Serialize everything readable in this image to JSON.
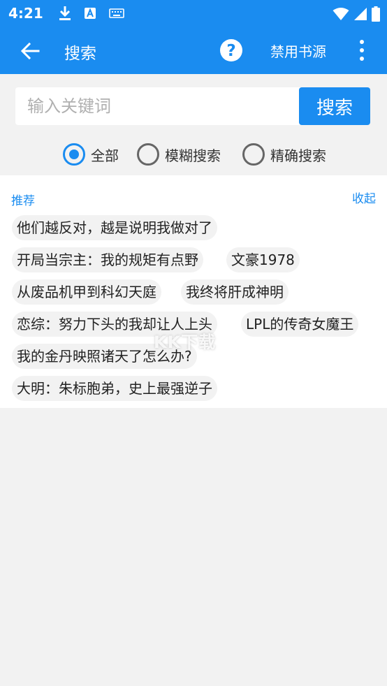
{
  "status": {
    "time": "4:21"
  },
  "appbar": {
    "title": "搜索",
    "disable_label": "禁用书源"
  },
  "search": {
    "placeholder": "输入关键词",
    "button_label": "搜索"
  },
  "radios": [
    {
      "label": "全部",
      "checked": true
    },
    {
      "label": "模糊搜索",
      "checked": false
    },
    {
      "label": "精确搜索",
      "checked": false
    }
  ],
  "recommend": {
    "title": "推荐",
    "collapse_label": "收起",
    "items": [
      "他们越反对，越是说明我做对了",
      "开局当宗主：我的规矩有点野",
      "文豪1978",
      "从废品机甲到科幻天庭",
      "我终将肝成神明",
      "恋综：努力下头的我却让人上头",
      "LPL的传奇女魔王",
      "我的金丹映照诸天了怎么办?",
      "大明：朱标胞弟，史上最强逆子"
    ]
  },
  "watermark": {
    "text": "KK下载",
    "sub": "net"
  },
  "colors": {
    "accent": "#1a8cf0",
    "background": "#f2f2f2"
  }
}
